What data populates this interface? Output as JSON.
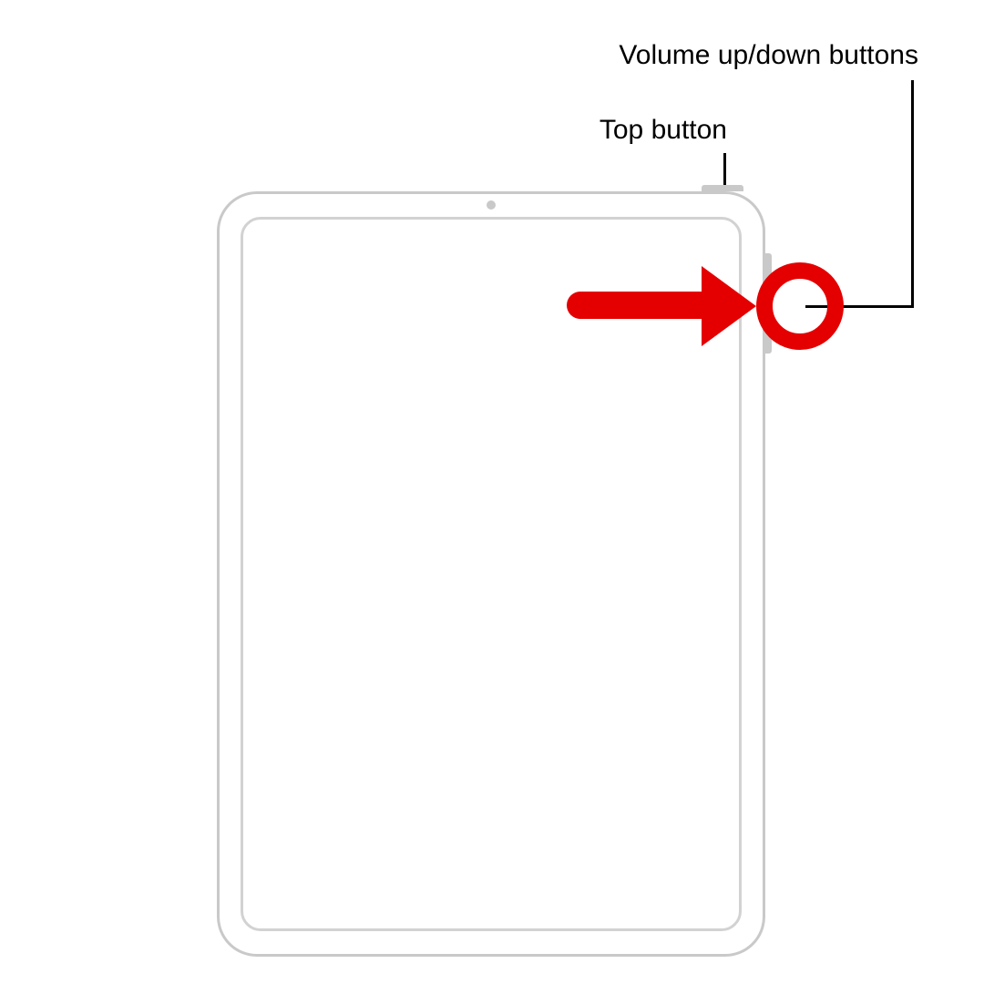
{
  "labels": {
    "volume": "Volume up/down buttons",
    "top_button": "Top button"
  },
  "highlight": {
    "target": "volume-buttons",
    "color": "#e40000"
  },
  "device": {
    "type": "iPad",
    "outline_color": "#c9c9c9"
  }
}
